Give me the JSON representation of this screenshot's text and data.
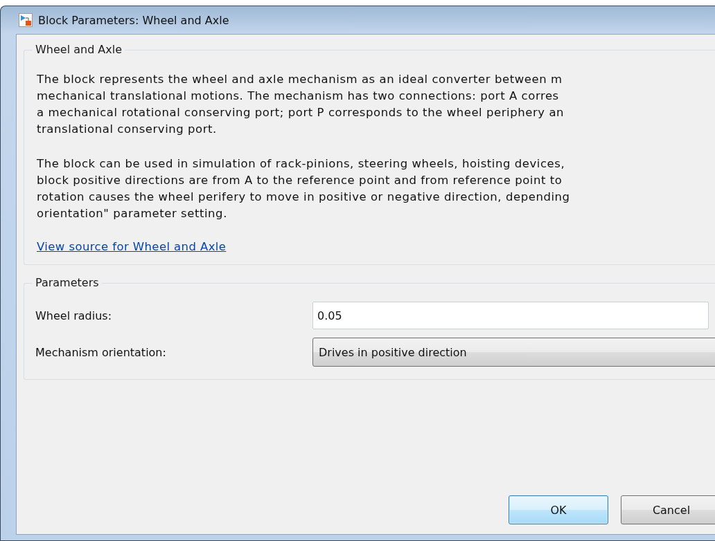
{
  "window": {
    "title": "Block Parameters: Wheel and Axle"
  },
  "description_group": {
    "title": "Wheel and Axle",
    "paragraphs": [
      [
        "The block represents the wheel and axle mechanism as an ideal converter between m",
        "mechanical translational motions. The mechanism has two connections: port A corres",
        "a mechanical rotational conserving port; port P corresponds to the wheel periphery an",
        "translational conserving port."
      ],
      [
        "The block can be used in simulation of rack-pinions, steering wheels, hoisting devices,",
        "block positive directions are from A to the reference point and from reference point to",
        "rotation causes the wheel perifery to move in positive or negative direction, depending",
        "orientation\" parameter setting."
      ]
    ],
    "link": "View source for Wheel and Axle"
  },
  "parameters_group": {
    "title": "Parameters",
    "fields": [
      {
        "kind": "text",
        "label": "Wheel radius:",
        "value": "0.05"
      },
      {
        "kind": "dropdown",
        "label": "Mechanism orientation:",
        "value": "Drives in positive direction"
      }
    ]
  },
  "buttons": [
    {
      "label": "OK",
      "default": true
    },
    {
      "label": "Cancel",
      "default": false
    }
  ]
}
